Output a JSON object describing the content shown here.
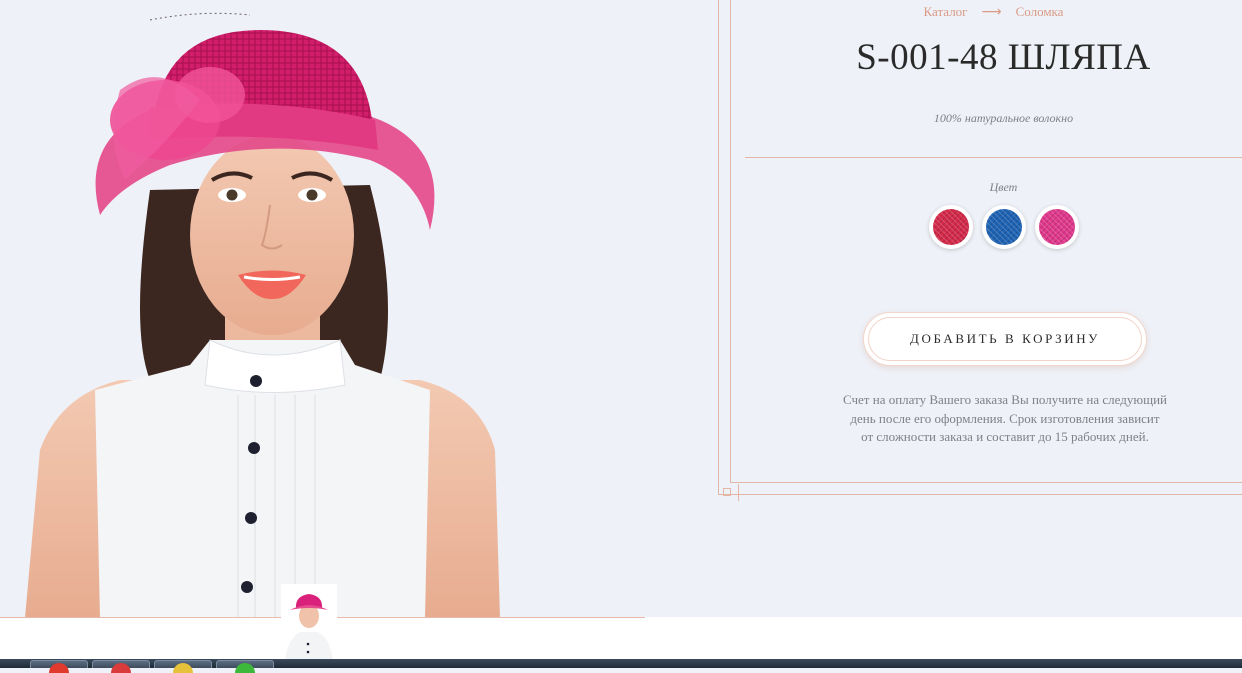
{
  "breadcrumb": {
    "catalog": "Каталог",
    "arrow": "⟶",
    "current": "Соломка"
  },
  "product": {
    "title": "S-001-48 ШЛЯПА",
    "material": "100% натуральное волокно"
  },
  "colors": {
    "label": "Цвет",
    "options": [
      {
        "name": "crimson",
        "hex": "#d42a4a"
      },
      {
        "name": "royal-blue",
        "hex": "#1f63b4"
      },
      {
        "name": "fuchsia",
        "hex": "#e0388c"
      }
    ]
  },
  "cart": {
    "button_label": "ДОБАВИТЬ В КОРЗИНУ"
  },
  "note": {
    "line1": "Счет на оплату Вашего заказа Вы получите на следующий",
    "line2": "день после его оформления. Срок изготовления зависит",
    "line3": "от сложности заказа и составит до 15 рабочих дней."
  },
  "gallery": {
    "thumbnails": [
      {
        "name": "main-photo"
      }
    ]
  },
  "taskbar": {
    "buttons": [
      {
        "icon": "opera-icon",
        "color": "#e03a2e"
      },
      {
        "icon": "opera-icon",
        "color": "#d93b3b"
      },
      {
        "icon": "app-icon",
        "color": "#e6c23a"
      },
      {
        "icon": "app-icon",
        "color": "#3db83a"
      }
    ]
  }
}
